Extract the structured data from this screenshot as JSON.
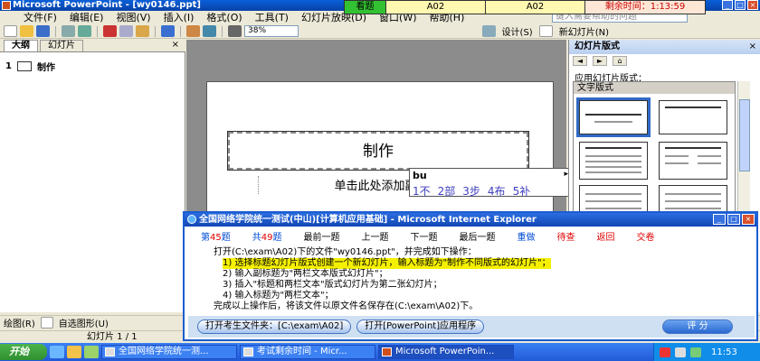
{
  "window": {
    "title": "Microsoft PowerPoint - [wy0146.ppt]"
  },
  "exam_bar": {
    "status": "看题",
    "cell1": "A02",
    "cell2": "A02",
    "time_label": "剩余时间：1:13:59"
  },
  "menu": {
    "items": [
      "文件(F)",
      "编辑(E)",
      "视图(V)",
      "插入(I)",
      "格式(O)",
      "工具(T)",
      "幻灯片放映(D)",
      "窗口(W)",
      "帮助(H)"
    ],
    "help_placeholder": "键入需要帮助的问题"
  },
  "toolbar": {
    "zoom": "38%",
    "design_label": "设计(S)",
    "new_slide_label": "新幻灯片(N)"
  },
  "outline_pane": {
    "tabs": [
      "大纲",
      "幻灯片"
    ],
    "close": "×",
    "item_number": "1",
    "item_label": "制作"
  },
  "slide": {
    "title": "制作",
    "subtitle": "单击此处添加副"
  },
  "ime": {
    "code": "bu",
    "candidates": [
      "1不",
      "2部",
      "3步",
      "4布",
      "5补"
    ],
    "arrow": "▸"
  },
  "task_pane": {
    "title": "幻灯片版式",
    "close": "×",
    "apply_to": "应用幻灯片版式：",
    "section": "文字版式"
  },
  "drawbar": {
    "draw_label": "绘图(R)",
    "autoshape_label": "自选图形(U)"
  },
  "statusbar": {
    "text": "幻灯片 1 / 1"
  },
  "dialog": {
    "title": "全国网络学院统一测试(中山)[计算机应用基础] - Microsoft Internet Explorer",
    "nav": {
      "current_prefix": "第",
      "current_num": "45",
      "current_suffix": "题",
      "total_prefix": "共",
      "total_num": "49",
      "total_suffix": "题",
      "first": "最前一题",
      "prev": "上一题",
      "next": "下一题",
      "last": "最后一题",
      "redo": "重做",
      "pending": "待查",
      "back": "返回",
      "submit": "交卷"
    },
    "lines": [
      "打开(C:\\exam\\A02)下的文件\"wy0146.ppt\"，并完成如下操作：",
      "1) 选择标题幻灯片版式创建一个新幻灯片，输入标题为\"制作不同版式的幻灯片\"；",
      "2) 输入副标题为\"两栏文本版式幻灯片\"；",
      "3) 插入\"标题和两栏文本\"版式幻灯片为第二张幻灯片；",
      "4) 输入标题为\"两栏文本\"；",
      "完成以上操作后，将该文件以原文件名保存在(C:\\exam\\A02)下。"
    ],
    "btn_open_folder": "打开考生文件夹：[C:\\exam\\A02]",
    "btn_open_app": "打开[PowerPoint]应用程序",
    "btn_score": "评 分"
  },
  "taskbar": {
    "start": "开始",
    "tasks": [
      "全国网络学院统一测...",
      "考试剩余时间 - Micr...",
      "Microsoft PowerPoin..."
    ],
    "clock": "11:53"
  }
}
